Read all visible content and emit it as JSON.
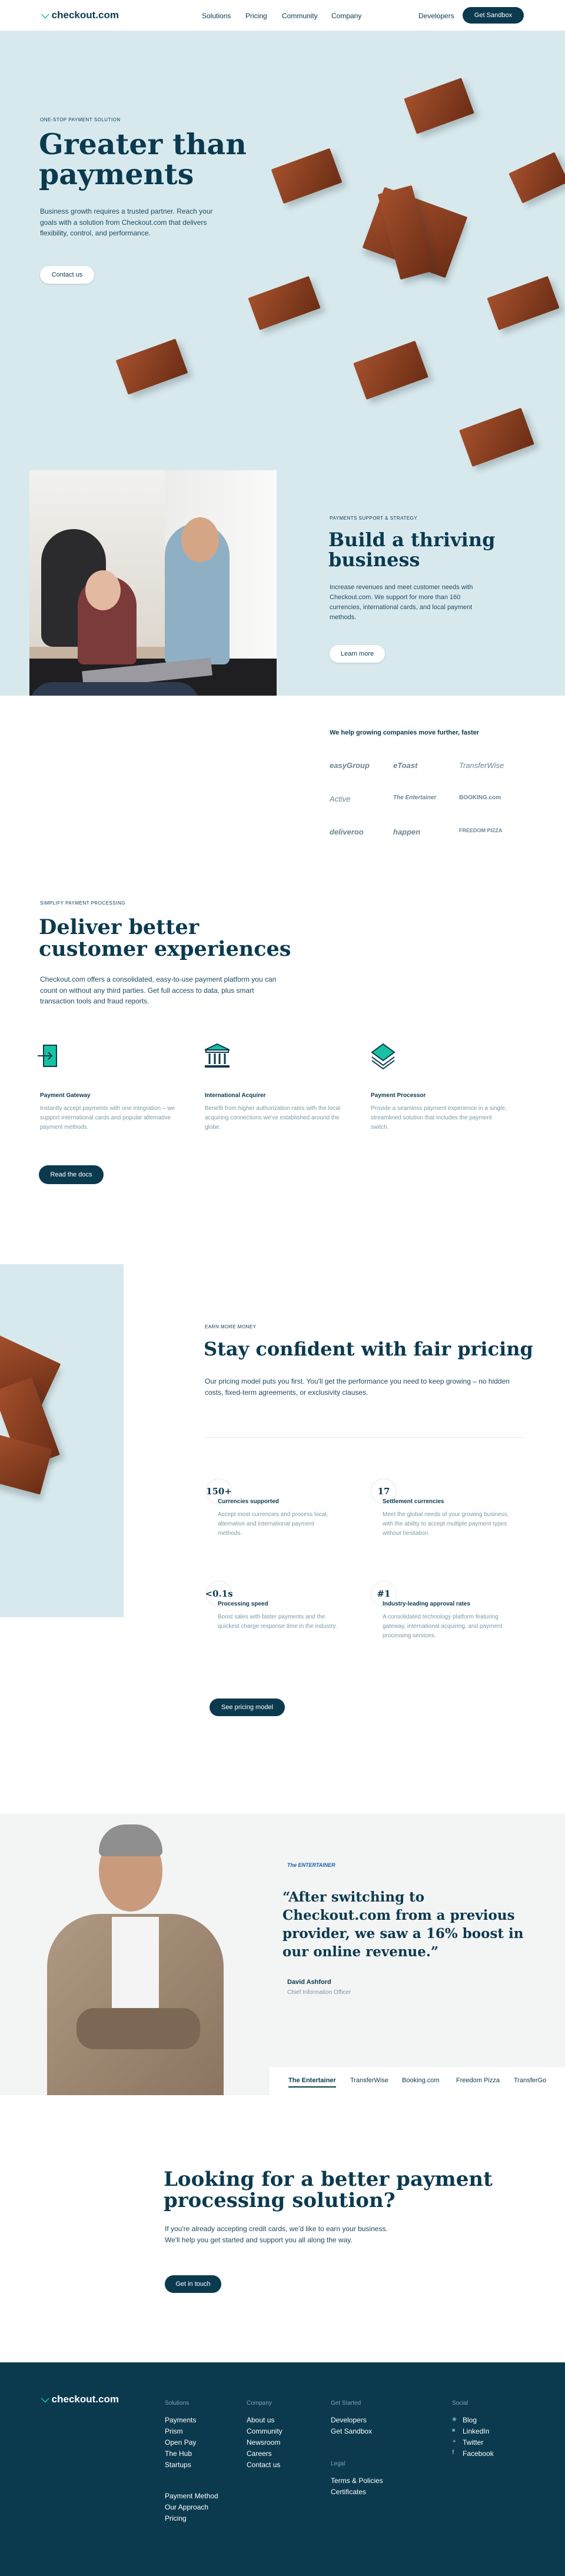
{
  "nav": {
    "brand": "checkout.com",
    "links": [
      "Solutions",
      "Pricing",
      "Community",
      "Company"
    ],
    "developers": "Developers",
    "cta": "Get Sandbox"
  },
  "hero": {
    "eyebrow": "ONE-STOP PAYMENT SOLUTION",
    "title_line1": "Greater than",
    "title_line2": "payments",
    "body": "Business growth requires a trusted partner. Reach your goals with a solution from Checkout.com that delivers flexibility, control, and performance.",
    "cta": "Contact us"
  },
  "thrive": {
    "eyebrow": "PAYMENTS SUPPORT & STRATEGY",
    "title_line1": "Build a thriving",
    "title_line2": "business",
    "body": "Increase revenues and meet customer needs with Checkout.com. We support for more than 160 currencies, international cards, and local payment methods.",
    "cta": "Learn more",
    "partners_heading": "We help growing companies move further, faster",
    "partners": [
      "easyGroup",
      "eToast",
      "TransferWise",
      "Active",
      "The Entertainer",
      "BOOKING.com",
      "deliveroo",
      "happen",
      "FREEDOM PIZZA"
    ]
  },
  "deliver": {
    "eyebrow": "SIMPLIFY PAYMENT PROCESSING",
    "title_line1": "Deliver better",
    "title_line2": "customer experiences",
    "body": "Checkout.com offers a consolidated, easy-to-use payment platform you can count on without any third parties. Get full access to data, plus smart transaction tools and fraud reports.",
    "features": [
      {
        "title": "Payment Gateway",
        "text": "Instantly accept payments with one integration – we support international cards and popular alternative payment methods."
      },
      {
        "title": "International Acquirer",
        "text": "Benefit from higher authorization rates with the local acquiring connections we've established around the globe."
      },
      {
        "title": "Payment Processor",
        "text": "Provide a seamless payment experience in a single, streamlined solution that includes the payment switch."
      }
    ],
    "cta": "Read the docs"
  },
  "pricing": {
    "eyebrow": "EARN MORE MONEY",
    "title": "Stay confident with fair pricing",
    "body": "Our pricing model puts you first. You'll get the performance you need to keep growing – no hidden costs, fixed-term agreements, or exclusivity clauses.",
    "stats": [
      {
        "value": "150+",
        "title": "Currencies supported",
        "text": "Accept most currencies and process local, alternative and international payment methods."
      },
      {
        "value": "17",
        "title": "Settlement currencies",
        "text": "Meet the global needs of your growing business, with the ability to accept multiple payment types without hesitation."
      },
      {
        "value": "<0.1s",
        "title": "Processing speed",
        "text": "Boost sales with faster payments and the quickest charge response time in the industry."
      },
      {
        "value": "#1",
        "title": "Industry-leading approval rates",
        "text": "A consolidated technology platform featuring gateway, international acquiring, and payment processing services."
      }
    ],
    "cta": "See pricing model"
  },
  "testimonial": {
    "brand": "The ENTERTAINER",
    "quote": "“After switching to Checkout.com from a previous provider, we saw a 16% boost in our online revenue.”",
    "name": "David Ashford",
    "role": "Chief Information Officer",
    "tabs": [
      "The Entertainer",
      "TransferWise",
      "Booking.com",
      "Freedom Pizza",
      "TransferGo"
    ]
  },
  "cta_section": {
    "title_line1": "Looking for a better payment",
    "title_line2": "processing solution?",
    "body_line1": "If you're already accepting credit cards, we'd like to earn your business.",
    "body_line2": "We'll help you get started and support you all along the way.",
    "cta": "Get in touch"
  },
  "footer": {
    "brand": "checkout.com",
    "col1_head": "Solutions",
    "col1": [
      "Payments",
      "Prism",
      "Open Pay",
      "The Hub",
      "Startups"
    ],
    "col1b": [
      "Payment Method",
      "Our Approach",
      "Pricing"
    ],
    "col2_head": "Company",
    "col2": [
      "About us",
      "Community",
      "Newsroom",
      "Careers",
      "Contact us"
    ],
    "col3_head": "Get Started",
    "col3": [
      "Developers",
      "Get Sandbox"
    ],
    "col3b_head": "Legal",
    "col3b": [
      "Terms & Policies",
      "Certificates"
    ],
    "col4_head": "Social",
    "col4": [
      "Blog",
      "LinkedIn",
      "Twitter",
      "Facebook"
    ]
  },
  "colors": {
    "navy": "#0b3a4f",
    "teal": "#16c2a3",
    "hero_bg": "#d8e9ee",
    "block": "#9a4a29"
  }
}
